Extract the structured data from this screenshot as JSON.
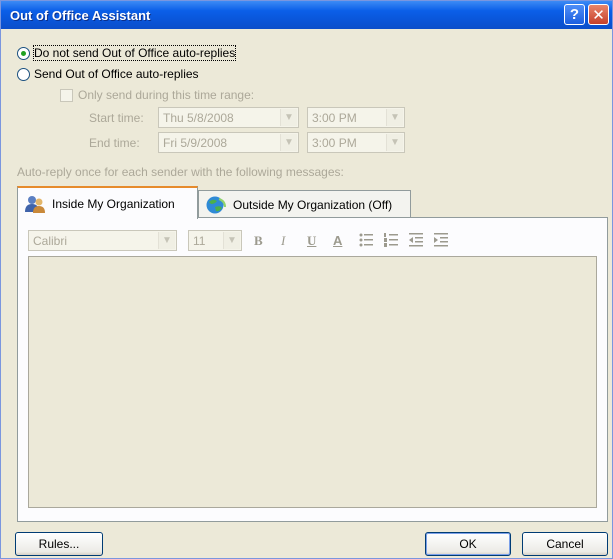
{
  "window": {
    "title": "Out of Office Assistant",
    "help_glyph": "?",
    "close_glyph": "✕"
  },
  "options": {
    "no_send_label": "Do not send Out of Office auto-replies",
    "send_label": "Send Out of Office auto-replies",
    "selected": "no_send"
  },
  "time_range": {
    "checkbox_label": "Only send during this time range:",
    "start_label": "Start time:",
    "start_date": "Thu 5/8/2008",
    "start_time": "3:00 PM",
    "end_label": "End time:",
    "end_date": "Fri 5/9/2008",
    "end_time": "3:00 PM"
  },
  "autoreply_label": "Auto-reply once for each sender with the following messages:",
  "tabs": [
    {
      "label": "Inside My Organization",
      "icon": "people-icon",
      "active": true
    },
    {
      "label": "Outside My Organization (Off)",
      "icon": "globe-icon",
      "active": false
    }
  ],
  "toolbar": {
    "font": "Calibri",
    "size": "11",
    "bold": "B",
    "italic": "I",
    "underline": "U",
    "font_color": "A"
  },
  "buttons": {
    "rules": "Rules...",
    "ok": "OK",
    "cancel": "Cancel"
  },
  "colors": {
    "title_bar": "#0b5fe8",
    "active_tab_accent": "#e68b2c",
    "radio_dot": "#21a121",
    "disabled_text": "#aca899"
  }
}
